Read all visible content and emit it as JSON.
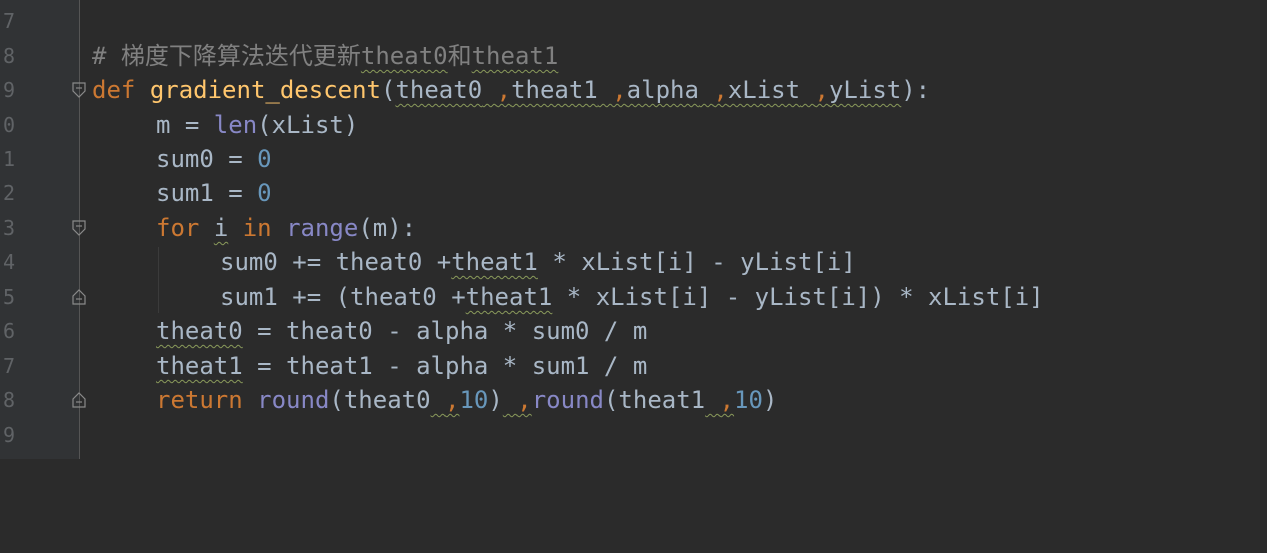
{
  "editor": {
    "line_numbers": [
      "7",
      "8",
      "9",
      "0",
      "1",
      "2",
      "3",
      "4",
      "5",
      "6",
      "7",
      "8",
      "9"
    ],
    "lines": {
      "l8": {
        "comment": "# 梯度下降算法迭代更新",
        "w1": "theat0",
        "c1": "和",
        "w2": "theat1"
      },
      "l9": {
        "def": "def",
        "fname": "gradient_descent",
        "open": "(",
        "p1": "theat0",
        "s1": " ",
        "c1": ",",
        "p2": "theat1",
        "s2": " ",
        "c2": ",",
        "p3": "alpha",
        "s3": " ",
        "c3": ",",
        "p4": "xList",
        "s4": " ",
        "c4": ",",
        "p5": "yList",
        "close": "):"
      },
      "l10": {
        "a": "m = ",
        "len": "len",
        "b": "(xList)"
      },
      "l11": {
        "a": "sum0 = ",
        "n": "0"
      },
      "l12": {
        "a": "sum1 = ",
        "n": "0"
      },
      "l13": {
        "for": "for",
        "sp1": " ",
        "i": "i",
        "sp2": " ",
        "in": "in",
        "sp3": " ",
        "range": "range",
        "rest": "(m):"
      },
      "l14": {
        "a": "sum0 += theat0 +",
        "t": "theat1",
        "b": " * xList[i] - yList[i]"
      },
      "l15": {
        "a": "sum1 += (theat0 +",
        "t": "theat1",
        "b": " * xList[i] - yList[i]) * xList[i]"
      },
      "l16": {
        "t": "theat0",
        "b": " = theat0 - alpha * sum0 / m"
      },
      "l17": {
        "t": "theat1",
        "b": " = theat1 - alpha * sum1 / m"
      },
      "l18": {
        "ret": "return",
        "sp": " ",
        "round1": "round",
        "a": "(theat0",
        "s1": " ",
        "c1": ",",
        "n1": "10",
        "b": ")",
        "s2": " ",
        "c2": ",",
        "round2": "round",
        "c": "(theat1",
        "s3": " ",
        "c3": ",",
        "n2": "10",
        "d": ")"
      }
    }
  },
  "colors": {
    "background": "#2b2b2b",
    "gutter": "#313335",
    "keyword": "#cc7832",
    "function": "#ffc66d",
    "builtin": "#8888c6",
    "number": "#6897bb",
    "comment": "#808080",
    "text": "#a9b7c6"
  }
}
